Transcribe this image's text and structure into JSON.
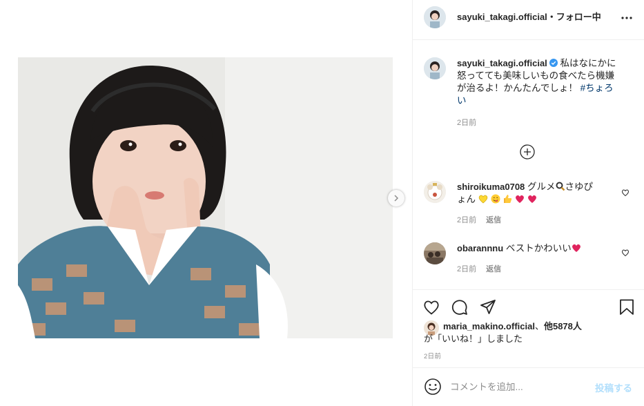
{
  "post": {
    "author": "sayuki_takagi.official",
    "follow_status": "・フォロー中",
    "caption_username": "sayuki_takagi.official",
    "caption_line1": "私はなにかに",
    "caption_line2": "怒ってても美味しいもの食べたら機嫌",
    "caption_line3": "が治るよ！かんたんでしょ！ ",
    "caption_hashtag_part1": "#ちょろ",
    "caption_hashtag_part2": "い",
    "caption_time": "2日前"
  },
  "comments": [
    {
      "username": "shiroikuma0708",
      "text_line1": " グルメ",
      "text_line1_tail": "さゆぴ",
      "text_line2": "ょん",
      "time": "2日前",
      "reply_label": "返信"
    },
    {
      "username": "obarannnu",
      "text": " ベストかわいい",
      "time": "2日前",
      "reply_label": "返信"
    }
  ],
  "likes": {
    "liker": "maria_makino.official",
    "sep": "、",
    "others": "他5878人",
    "suffix": "が「いいね！」しました"
  },
  "post_date": "2日前",
  "comment_box": {
    "placeholder": "コメントを追加...",
    "post_label": "投稿する"
  },
  "colors": {
    "border": "#efefef",
    "text": "#262626",
    "meta": "#8e8e8e",
    "hashtag": "#00376b",
    "post_button_disabled": "#b2dffc",
    "verified": "#3897f0",
    "heart_emoji": "#e0245e"
  },
  "icons": {
    "more": "more-horizontal-icon",
    "load_more": "plus-circle-icon",
    "like": "heart-outline-icon",
    "comment": "comment-bubble-icon",
    "share": "paper-plane-icon",
    "save": "bookmark-icon",
    "emoji": "smiley-icon",
    "next": "chevron-right-icon"
  }
}
